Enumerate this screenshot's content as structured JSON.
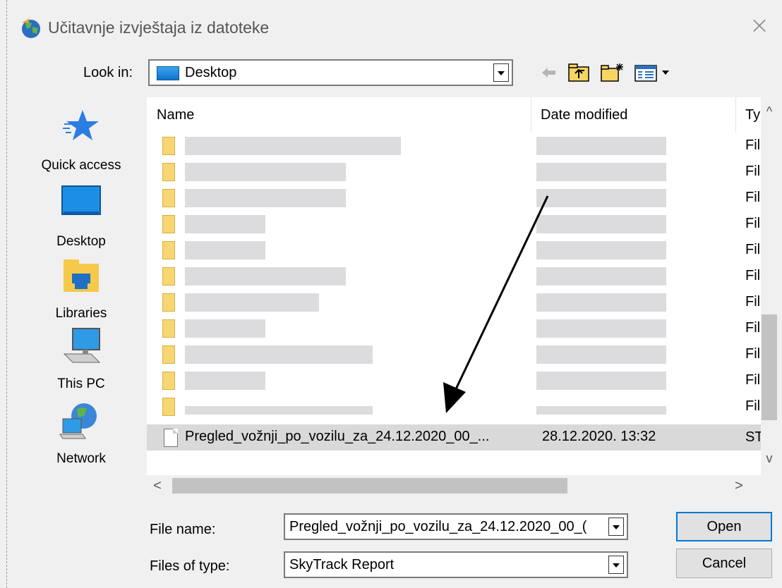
{
  "dialog": {
    "title": "Učitavnje izvještaja iz datoteke",
    "close_glyph": "×"
  },
  "lookin": {
    "label": "Look in:",
    "value": "Desktop"
  },
  "toolbar": {
    "icons": [
      "back-arrow-icon",
      "up-folder-icon",
      "new-folder-icon",
      "view-menu-icon"
    ]
  },
  "places": [
    {
      "label": "Quick access",
      "icon": "star-icon"
    },
    {
      "label": "Desktop",
      "icon": "desktop-icon"
    },
    {
      "label": "Libraries",
      "icon": "libraries-icon"
    },
    {
      "label": "This PC",
      "icon": "computer-icon"
    },
    {
      "label": "Network",
      "icon": "network-icon"
    }
  ],
  "filelist": {
    "columns": {
      "name": "Name",
      "date": "Date modified",
      "type": "Ty"
    },
    "folder_type": "Fil",
    "folder_count": 11,
    "selected": {
      "name": "Pregled_vožnji_po_vozilu_za_24.12.2020_00_...",
      "date": "28.12.2020. 13:32",
      "type": "ST"
    }
  },
  "footer": {
    "filename_label": "File name:",
    "filename_value": "Pregled_vožnji_po_vozilu_za_24.12.2020_00_(",
    "filetype_label": "Files of type:",
    "filetype_value": "SkyTrack Report",
    "open_label": "Open",
    "cancel_label": "Cancel"
  },
  "colors": {
    "selection": "#d9d9d9",
    "default_button_border": "#0078d7",
    "folder": "#f8d673",
    "annotation_arrow": "#000000"
  }
}
